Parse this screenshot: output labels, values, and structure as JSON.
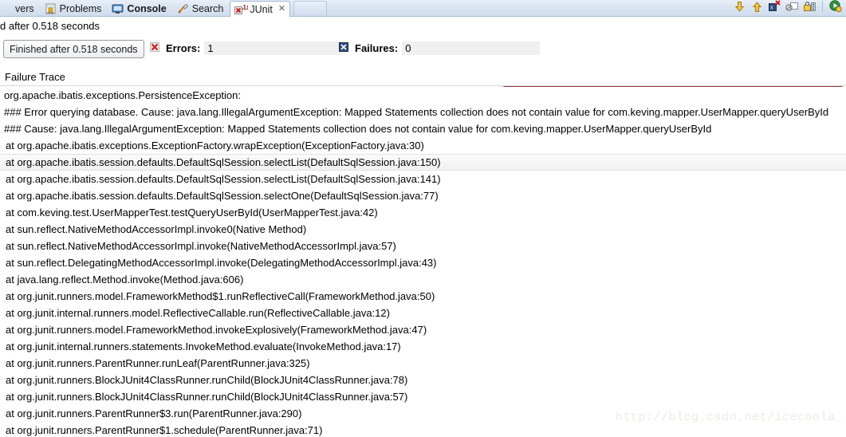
{
  "tabbar": {
    "tabs": [
      {
        "label": "vers",
        "icon": "servers-icon",
        "active": false,
        "truncated": true
      },
      {
        "label": "Problems",
        "icon": "problems-icon",
        "active": false
      },
      {
        "label": "Console",
        "icon": "console-icon",
        "active": false,
        "bold": true
      },
      {
        "label": "Search",
        "icon": "search-icon",
        "active": false
      },
      {
        "label": "JUnit",
        "icon": "junit-icon",
        "active": true,
        "close": "✕"
      }
    ],
    "toolbar": [
      {
        "name": "next-failure-icon",
        "title": "Next Failed Test"
      },
      {
        "name": "previous-failure-icon",
        "title": "Previous Failed Test"
      },
      {
        "name": "show-failures-only-icon",
        "title": "Show Failures Only"
      },
      {
        "name": "stop-icon",
        "title": "Stop JUnit Test Run"
      },
      {
        "name": "pin-test-run-icon",
        "title": "Pin Test Run"
      },
      {
        "name": "rerun-test-icon",
        "title": "Rerun Test"
      }
    ]
  },
  "statusline": {
    "text": "d after 0.518 seconds"
  },
  "counters": {
    "finished_label": "Finished after 0.518 seconds",
    "errors_label": "Errors:",
    "errors_value": "1",
    "failures_label": "Failures:",
    "failures_value": "0",
    "progress_percent": 100,
    "progress_color": "#9e3b3d"
  },
  "failure_trace": {
    "header": "Failure Trace",
    "hover_row_index": 4,
    "lines": [
      "org.apache.ibatis.exceptions.PersistenceException:",
      "### Error querying database.  Cause: java.lang.IllegalArgumentException: Mapped Statements collection does not contain value for com.keving.mapper.UserMapper.queryUserById",
      "### Cause: java.lang.IllegalArgumentException: Mapped Statements collection does not contain value for com.keving.mapper.UserMapper.queryUserById",
      "at org.apache.ibatis.exceptions.ExceptionFactory.wrapException(ExceptionFactory.java:30)",
      "at org.apache.ibatis.session.defaults.DefaultSqlSession.selectList(DefaultSqlSession.java:150)",
      "at org.apache.ibatis.session.defaults.DefaultSqlSession.selectList(DefaultSqlSession.java:141)",
      "at org.apache.ibatis.session.defaults.DefaultSqlSession.selectOne(DefaultSqlSession.java:77)",
      "at com.keving.test.UserMapperTest.testQueryUserById(UserMapperTest.java:42)",
      "at sun.reflect.NativeMethodAccessorImpl.invoke0(Native Method)",
      "at sun.reflect.NativeMethodAccessorImpl.invoke(NativeMethodAccessorImpl.java:57)",
      "at sun.reflect.DelegatingMethodAccessorImpl.invoke(DelegatingMethodAccessorImpl.java:43)",
      "at java.lang.reflect.Method.invoke(Method.java:606)",
      "at org.junit.runners.model.FrameworkMethod$1.runReflectiveCall(FrameworkMethod.java:50)",
      "at org.junit.internal.runners.model.ReflectiveCallable.run(ReflectiveCallable.java:12)",
      "at org.junit.runners.model.FrameworkMethod.invokeExplosively(FrameworkMethod.java:47)",
      "at org.junit.internal.runners.statements.InvokeMethod.evaluate(InvokeMethod.java:17)",
      "at org.junit.runners.ParentRunner.runLeaf(ParentRunner.java:325)",
      "at org.junit.runners.BlockJUnit4ClassRunner.runChild(BlockJUnit4ClassRunner.java:78)",
      "at org.junit.runners.BlockJUnit4ClassRunner.runChild(BlockJUnit4ClassRunner.java:57)",
      "at org.junit.runners.ParentRunner$3.run(ParentRunner.java:290)",
      "at org.junit.runners.ParentRunner$1.schedule(ParentRunner.java:71)"
    ]
  },
  "watermark": {
    "text": "http://blog.csdn.net/icecoola_"
  }
}
